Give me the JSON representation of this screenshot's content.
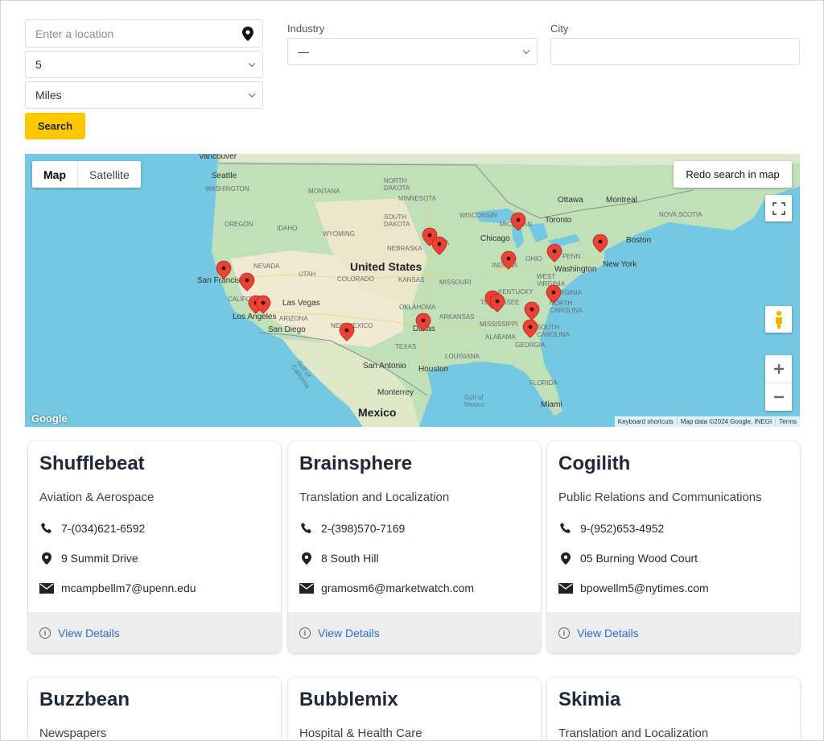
{
  "filters": {
    "location_placeholder": "Enter a location",
    "radius_value": "5",
    "unit_value": "Miles",
    "search_label": "Search",
    "industry_label": "Industry",
    "industry_value": "—",
    "city_label": "City",
    "city_value": ""
  },
  "map": {
    "type_map": "Map",
    "type_satellite": "Satellite",
    "redo_label": "Redo search in map",
    "google_logo": "Google",
    "attribution": {
      "shortcuts": "Keyboard shortcuts",
      "data": "Map data ©2024 Google, INEGI",
      "terms": "Terms"
    },
    "labels": {
      "vancouver": "Vancouver",
      "seattle": "Seattle",
      "washington_state": "WASHINGTON",
      "montana": "MONTANA",
      "north_dakota": "NORTH\nDAKOTA",
      "minnesota": "MINNESOTA",
      "ottawa": "Ottawa",
      "montreal": "Montreal",
      "oregon": "OREGON",
      "idaho": "IDAHO",
      "wyoming": "WYOMING",
      "south_dakota": "SOUTH\nDAKOTA",
      "wisconsin": "WISCONSIN",
      "michigan": "MICHIGAN",
      "toronto": "Toronto",
      "boston": "Boston",
      "nova_scotia": "NOVA SCOTIA",
      "nebraska": "NEBRASKA",
      "iowa": "IOWA",
      "chicago": "Chicago",
      "ohio": "OHIO",
      "penn": "PENN",
      "new_york": "New York",
      "nevada": "NEVADA",
      "united_states": "United States",
      "utah": "UTAH",
      "colorado": "COLORADO",
      "kansas": "KANSAS",
      "missouri": "MISSOURI",
      "indiana": "INDIANA",
      "washington_dc": "Washington",
      "san_francisco": "San Francisco",
      "california": "CALIFORNIA",
      "las_vegas": "Las Vegas",
      "los_angeles": "Los Angeles",
      "san_diego": "San Diego",
      "arizona": "ARIZONA",
      "new_mexico": "NEW MEXICO",
      "oklahoma": "OKLAHOMA",
      "arkansas": "ARKANSAS",
      "tennessee": "TENNESSEE",
      "kentucky": "KENTUCKY",
      "west_virginia": "WEST\nVIRGINIA",
      "virginia": "VIRGINIA",
      "north_carolina": "NORTH\nCAROLINA",
      "south_carolina": "SOUTH\nCAROLINA",
      "dallas": "Dallas",
      "mississippi": "MISSISSIPPI",
      "alabama": "ALABAMA",
      "georgia": "GEORGIA",
      "texas": "TEXAS",
      "louisiana": "LOUISIANA",
      "san_antonio": "San Antonio",
      "houston": "Houston",
      "florida": "FLORIDA",
      "gulf_california": "Gulf of\nCalifornia",
      "monterrey": "Monterrey",
      "gulf_mexico": "Gulf of\nMexico",
      "miami": "Miami",
      "mexico": "Mexico"
    }
  },
  "cards": [
    {
      "name": "Shufflebeat",
      "industry": "Aviation & Aerospace",
      "phone": "7-(034)621-6592",
      "address": "9 Summit Drive",
      "email": "mcampbellm7@upenn.edu",
      "link": "View Details"
    },
    {
      "name": "Brainsphere",
      "industry": "Translation and Localization",
      "phone": "2-(398)570-7169",
      "address": "8 South Hill",
      "email": "gramosm6@marketwatch.com",
      "link": "View Details"
    },
    {
      "name": "Cogilith",
      "industry": "Public Relations and Communications",
      "phone": "9-(952)653-4952",
      "address": "05 Burning Wood Court",
      "email": "bpowellm5@nytimes.com",
      "link": "View Details"
    },
    {
      "name": "Buzzbean",
      "industry": "Newspapers"
    },
    {
      "name": "Bubblemix",
      "industry": "Hospital & Health Care"
    },
    {
      "name": "Skimia",
      "industry": "Translation and Localization"
    }
  ],
  "colors": {
    "accent": "#ffc800",
    "link": "#2f6fd6",
    "marker": "#ea4335",
    "water": "#74c8e2"
  }
}
